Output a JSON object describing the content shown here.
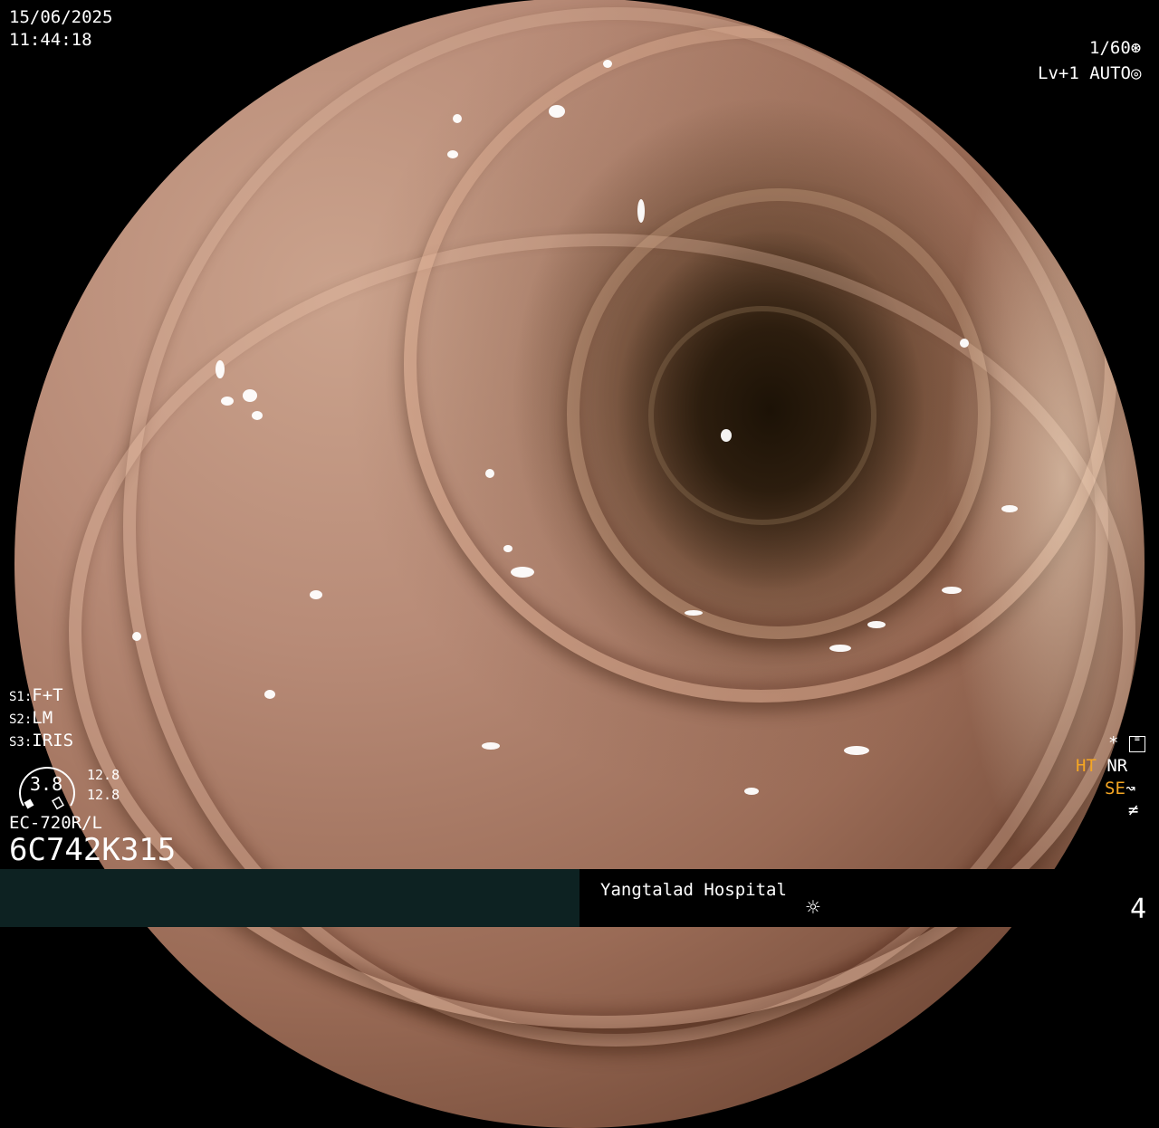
{
  "datetime": {
    "date": "15/06/2025",
    "time": "11:44:18"
  },
  "top_right": {
    "shutter": "1/60",
    "shutter_icon": "shutter-icon",
    "level": "Lv+1",
    "mode": "AUTO",
    "mode_icon": "iris-icon"
  },
  "settings": [
    {
      "key": "S1",
      "value": "F+T"
    },
    {
      "key": "S2",
      "value": "LM"
    },
    {
      "key": "S3",
      "value": "IRIS"
    }
  ],
  "zoom_gauge": {
    "value": "3.8",
    "top": "12.8",
    "bottom": "12.8"
  },
  "scope": {
    "model": "EC-720R/L",
    "serial": "6C742K315"
  },
  "enhance": {
    "star": "*",
    "menu_icon": "settings-menu-icon",
    "ht": "HT",
    "nr": "NR",
    "se": "SE",
    "se_icon": "se-curve-icon",
    "not_equal": "≠"
  },
  "footer": {
    "hospital": "Yangtalad Hospital",
    "light_icon": "sun-icon",
    "page": "4"
  },
  "colors": {
    "accent": "#f5a623",
    "footer_bg": "#0d2222"
  }
}
